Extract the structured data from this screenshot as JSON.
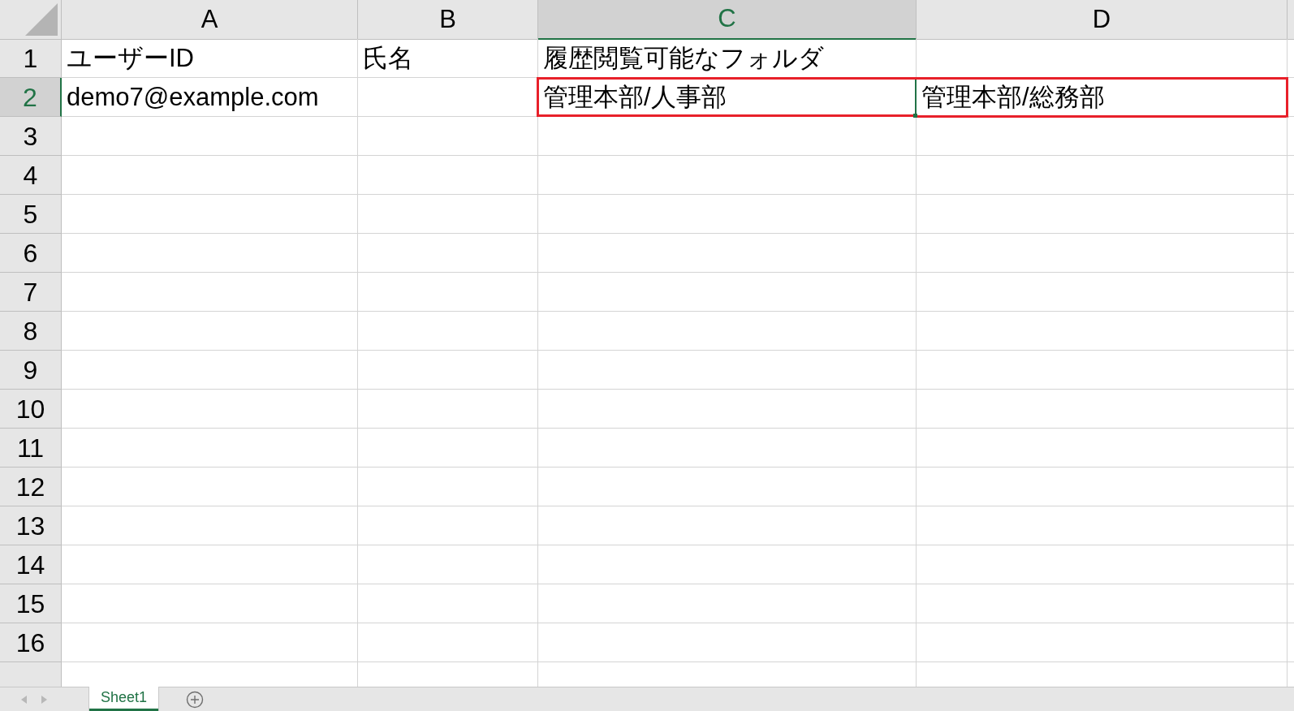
{
  "columns": [
    {
      "label": "A",
      "selected": false
    },
    {
      "label": "B",
      "selected": false
    },
    {
      "label": "C",
      "selected": true
    },
    {
      "label": "D",
      "selected": false
    }
  ],
  "rows": [
    {
      "number": "1",
      "selected": false,
      "cells": [
        {
          "text": "ユーザーID",
          "active": false,
          "highlighted": false
        },
        {
          "text": "氏名",
          "active": false,
          "highlighted": false
        },
        {
          "text": "履歴閲覧可能なフォルダ",
          "active": false,
          "highlighted": false
        },
        {
          "active": false,
          "highlighted": false
        }
      ]
    },
    {
      "number": "2",
      "selected": true,
      "cells": [
        {
          "text": "demo7@example.com",
          "active": false,
          "highlighted": false
        },
        {
          "active": false,
          "highlighted": false
        },
        {
          "text": "管理本部/人事部",
          "active": true,
          "highlighted": true
        },
        {
          "text": "管理本部/総務部",
          "active": false,
          "highlighted": true
        }
      ]
    },
    {
      "number": "3",
      "selected": false
    },
    {
      "number": "4",
      "selected": false
    },
    {
      "number": "5",
      "selected": false
    },
    {
      "number": "6",
      "selected": false
    },
    {
      "number": "7",
      "selected": false
    },
    {
      "number": "8",
      "selected": false
    },
    {
      "number": "9",
      "selected": false
    },
    {
      "number": "10",
      "selected": false
    },
    {
      "number": "11",
      "selected": false
    },
    {
      "number": "12",
      "selected": false
    },
    {
      "number": "13",
      "selected": false
    },
    {
      "number": "14",
      "selected": false
    },
    {
      "number": "15",
      "selected": false
    },
    {
      "number": "16",
      "selected": false
    }
  ],
  "sheet_tabs": [
    {
      "label": "Sheet1",
      "selected": true
    }
  ]
}
